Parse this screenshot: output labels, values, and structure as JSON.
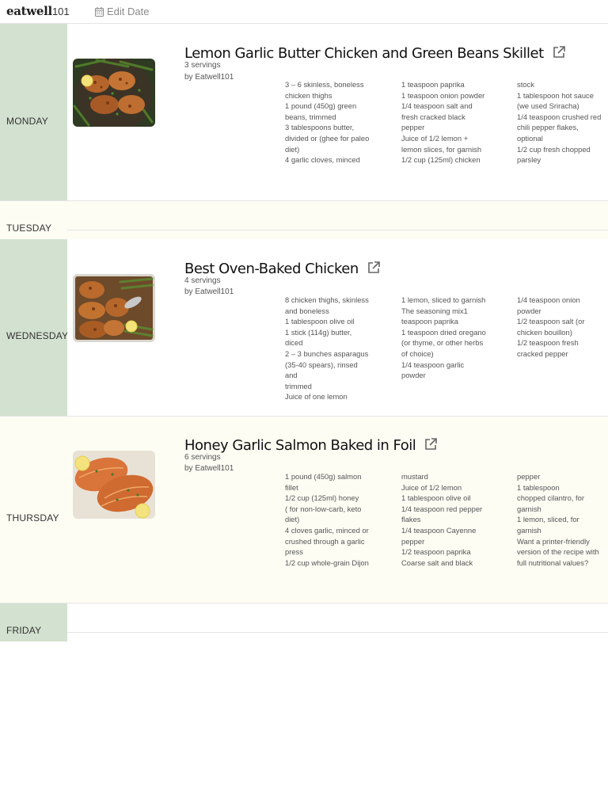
{
  "header": {
    "logo_word": "eatwell",
    "logo_num": "101",
    "edit_date_label": "Edit Date"
  },
  "days": {
    "monday": "MONDAY",
    "tuesday": "TUESDAY",
    "wednesday": "WEDNESDAY",
    "thursday": "THURSDAY",
    "friday": "FRIDAY"
  },
  "recipes": [
    {
      "title": "Lemon Garlic Butter Chicken and Green Beans Skillet",
      "servings": "3 servings",
      "byline": "by Eatwell101",
      "col1": [
        "3 – 6 skinless, boneless",
        "chicken thighs",
        "1 pound (450g) green",
        "beans, trimmed",
        "3 tablespoons butter,",
        "divided or (ghee for paleo",
        "diet)",
        "4 garlic cloves, minced"
      ],
      "col2": [
        "1 teaspoon paprika",
        "1 teaspoon onion powder",
        "1/4 teaspoon salt and",
        "fresh cracked black",
        "pepper",
        "Juice of 1/2 lemon +",
        "lemon slices, for garnish",
        "1/2 cup (125ml) chicken"
      ],
      "col3": [
        "stock",
        "1 tablespoon hot sauce",
        "(we used Sriracha)",
        "1/4 teaspoon crushed red",
        "chili pepper flakes,",
        "optional",
        "1/2 cup fresh chopped",
        "parsley"
      ]
    },
    {
      "title": "Best Oven-Baked Chicken",
      "servings": "4 servings",
      "byline": "by Eatwell101",
      "col1": [
        "8 chicken thighs, skinless",
        "and boneless",
        "1 tablespoon olive oil",
        "1 stick (114g) butter, diced",
        "2 – 3 bunches asparagus",
        "(35-40 spears), rinsed and",
        "trimmed",
        "Juice of one lemon"
      ],
      "col2": [
        "1 lemon, sliced to garnish",
        "The seasoning mix1",
        "teaspoon paprika",
        "1 teaspoon dried oregano",
        "(or thyme, or other herbs",
        "of choice)",
        "1/4 teaspoon garlic",
        "powder"
      ],
      "col3": [
        "1/4 teaspoon onion",
        "powder",
        "1/2 teaspoon salt (or",
        "chicken bouillon)",
        "1/2 teaspoon fresh",
        "cracked pepper"
      ]
    },
    {
      "title": "Honey Garlic Salmon Baked in Foil",
      "servings": "6 servings",
      "byline": "by Eatwell101",
      "col1": [
        "1 pound (450g) salmon",
        "fillet",
        "1/2 cup (125ml) honey",
        "( for non-low-carb, keto",
        "diet)",
        "4 cloves garlic, minced or",
        "crushed through a garlic",
        "press",
        "1/2 cup whole-grain Dijon"
      ],
      "col2": [
        "mustard",
        "Juice of 1/2 lemon",
        "1 tablespoon olive oil",
        "1/4 teaspoon red pepper",
        "flakes",
        "1/4 teaspoon Cayenne",
        "pepper",
        "1/2 teaspoon paprika",
        "Coarse salt and black"
      ],
      "col3": [
        "pepper",
        "1 tablespoon",
        "chopped cilantro, for",
        "garnish",
        "1 lemon, sliced, for",
        "garnish",
        "Want a printer-friendly",
        "version of the recipe with",
        "full nutritional values?"
      ]
    }
  ]
}
